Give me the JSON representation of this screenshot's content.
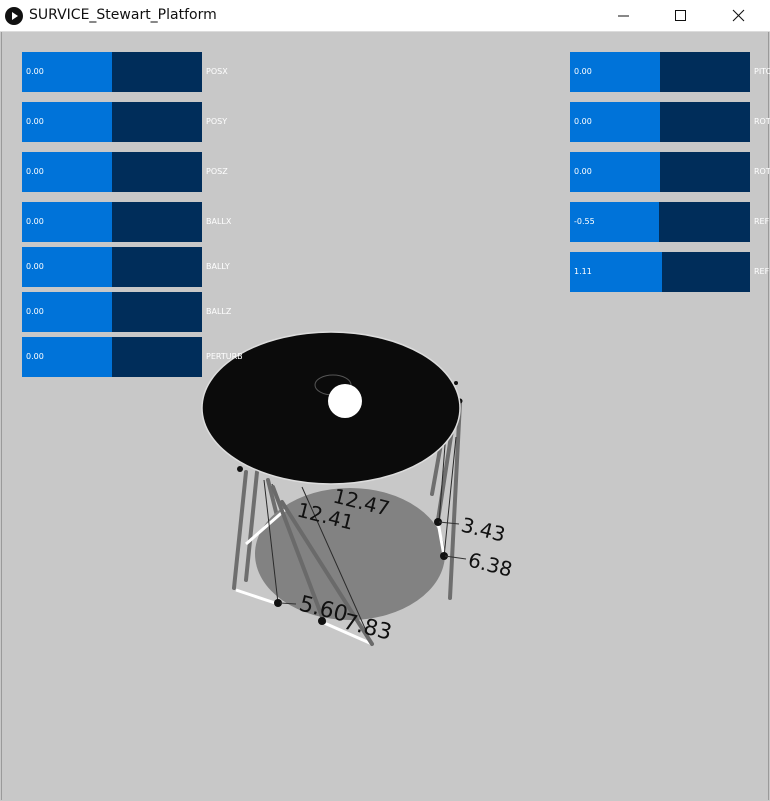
{
  "window": {
    "title": "SURVICE_Stewart_Platform",
    "icons": {
      "app": "processing-play-icon",
      "minimize": "minimize-icon",
      "maximize": "maximize-icon",
      "close": "close-icon"
    }
  },
  "sliders_left": [
    {
      "label": "POSX",
      "value": "0.00",
      "level": 0.5
    },
    {
      "label": "POSY",
      "value": "0.00",
      "level": 0.5
    },
    {
      "label": "POSZ",
      "value": "0.00",
      "level": 0.5
    },
    {
      "label": "BALLX",
      "value": "0.00",
      "level": 0.5
    },
    {
      "label": "BALLY",
      "value": "0.00",
      "level": 0.5
    },
    {
      "label": "BALLZ",
      "value": "0.00",
      "level": 0.5
    },
    {
      "label": "PERTURB",
      "value": "0.00",
      "level": 0.5
    }
  ],
  "sliders_right": [
    {
      "label": "PITC",
      "value": "0.00",
      "level": 0.5
    },
    {
      "label": "ROT",
      "value": "0.00",
      "level": 0.5
    },
    {
      "label": "ROTA",
      "value": "0.00",
      "level": 0.5
    },
    {
      "label": "REF",
      "value": "-0.55",
      "level": 0.495
    },
    {
      "label": "REF",
      "value": "1.11",
      "level": 0.51
    }
  ],
  "scene": {
    "leg_lengths": [
      "12.47",
      "12.41",
      "3.43",
      "6.38",
      "5.60",
      "7.83"
    ],
    "colors": {
      "top_platform": "#0b0b0b",
      "base_platform": "#828282",
      "ball": "#ffffff"
    }
  }
}
